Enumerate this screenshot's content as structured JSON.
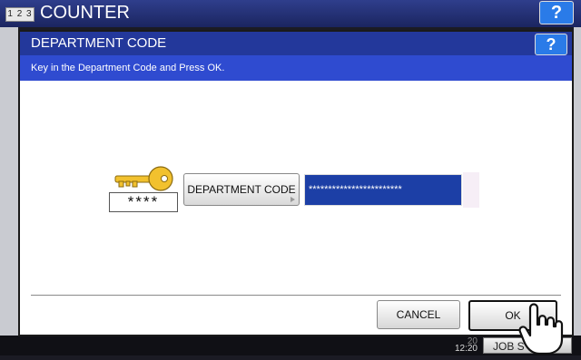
{
  "background": {
    "counter_icon": "1 2 3",
    "counter_title": "COUNTER",
    "help_label": "?",
    "clock_partial": "20",
    "clock_time": "12:20",
    "job_status_label": "JOB S"
  },
  "dialog": {
    "title": "DEPARTMENT CODE",
    "help_label": "?",
    "instruction": "Key in the Department Code and Press OK.",
    "masked_preview": "****",
    "department_code_button": "DEPARTMENT CODE",
    "code_value": "************************",
    "cancel_label": "CANCEL",
    "ok_label": "OK"
  },
  "icons": {
    "key": "key-icon",
    "hand": "pointing-hand-icon"
  },
  "colors": {
    "title_bar": "#23389b",
    "instruction_bar": "#2f4bd0",
    "code_field": "#1c3fa6",
    "help_button": "#2a7be8",
    "key": "#f2c12e"
  }
}
